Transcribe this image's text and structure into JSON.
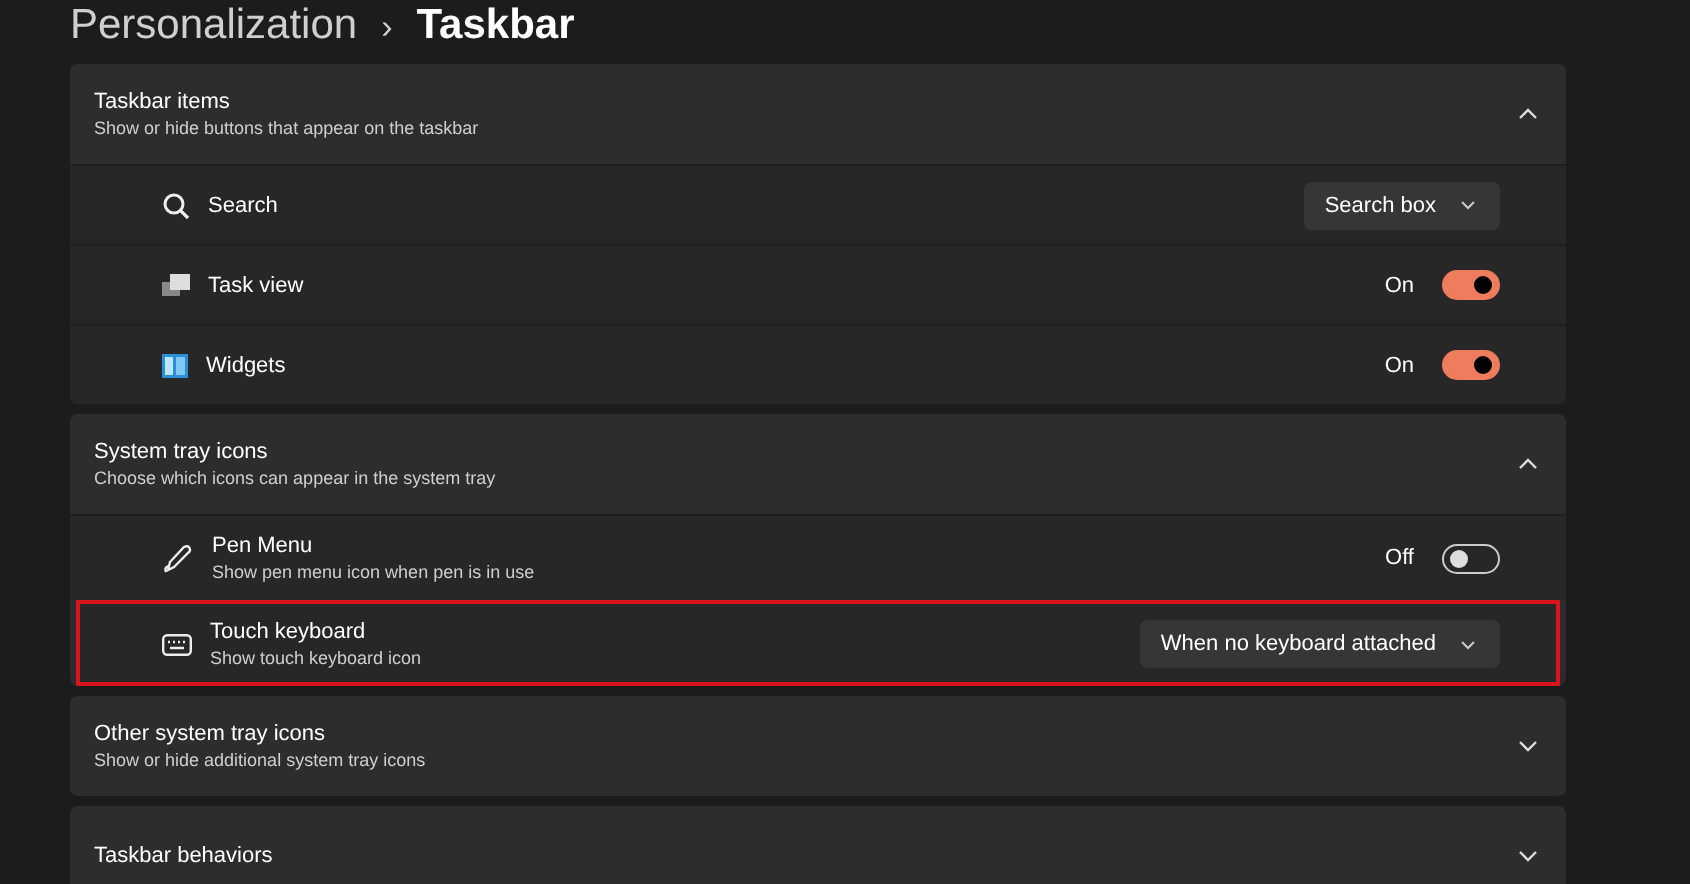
{
  "breadcrumb": {
    "parent": "Personalization",
    "separator": "›",
    "current": "Taskbar"
  },
  "sections": [
    {
      "title": "Taskbar items",
      "subtitle": "Show or hide buttons that appear on the taskbar",
      "expanded": true,
      "items": [
        {
          "kind": "dropdown",
          "label": "Search",
          "value": "Search box",
          "highlighted": false
        },
        {
          "kind": "toggle",
          "label": "Task view",
          "state_text": "On",
          "on": true,
          "highlighted": false
        },
        {
          "kind": "toggle",
          "label": "Widgets",
          "state_text": "On",
          "on": true,
          "highlighted": false
        }
      ]
    },
    {
      "title": "System tray icons",
      "subtitle": "Choose which icons can appear in the system tray",
      "expanded": true,
      "items": [
        {
          "kind": "toggle",
          "label": "Pen Menu",
          "description": "Show pen menu icon when pen is in use",
          "state_text": "Off",
          "on": false,
          "highlighted": false
        },
        {
          "kind": "dropdown",
          "label": "Touch keyboard",
          "description": "Show touch keyboard icon",
          "value": "When no keyboard attached",
          "highlighted": true
        }
      ]
    },
    {
      "title": "Other system tray icons",
      "subtitle": "Show or hide additional system tray icons",
      "expanded": false
    },
    {
      "title": "Taskbar behaviors",
      "expanded": false
    }
  ]
}
